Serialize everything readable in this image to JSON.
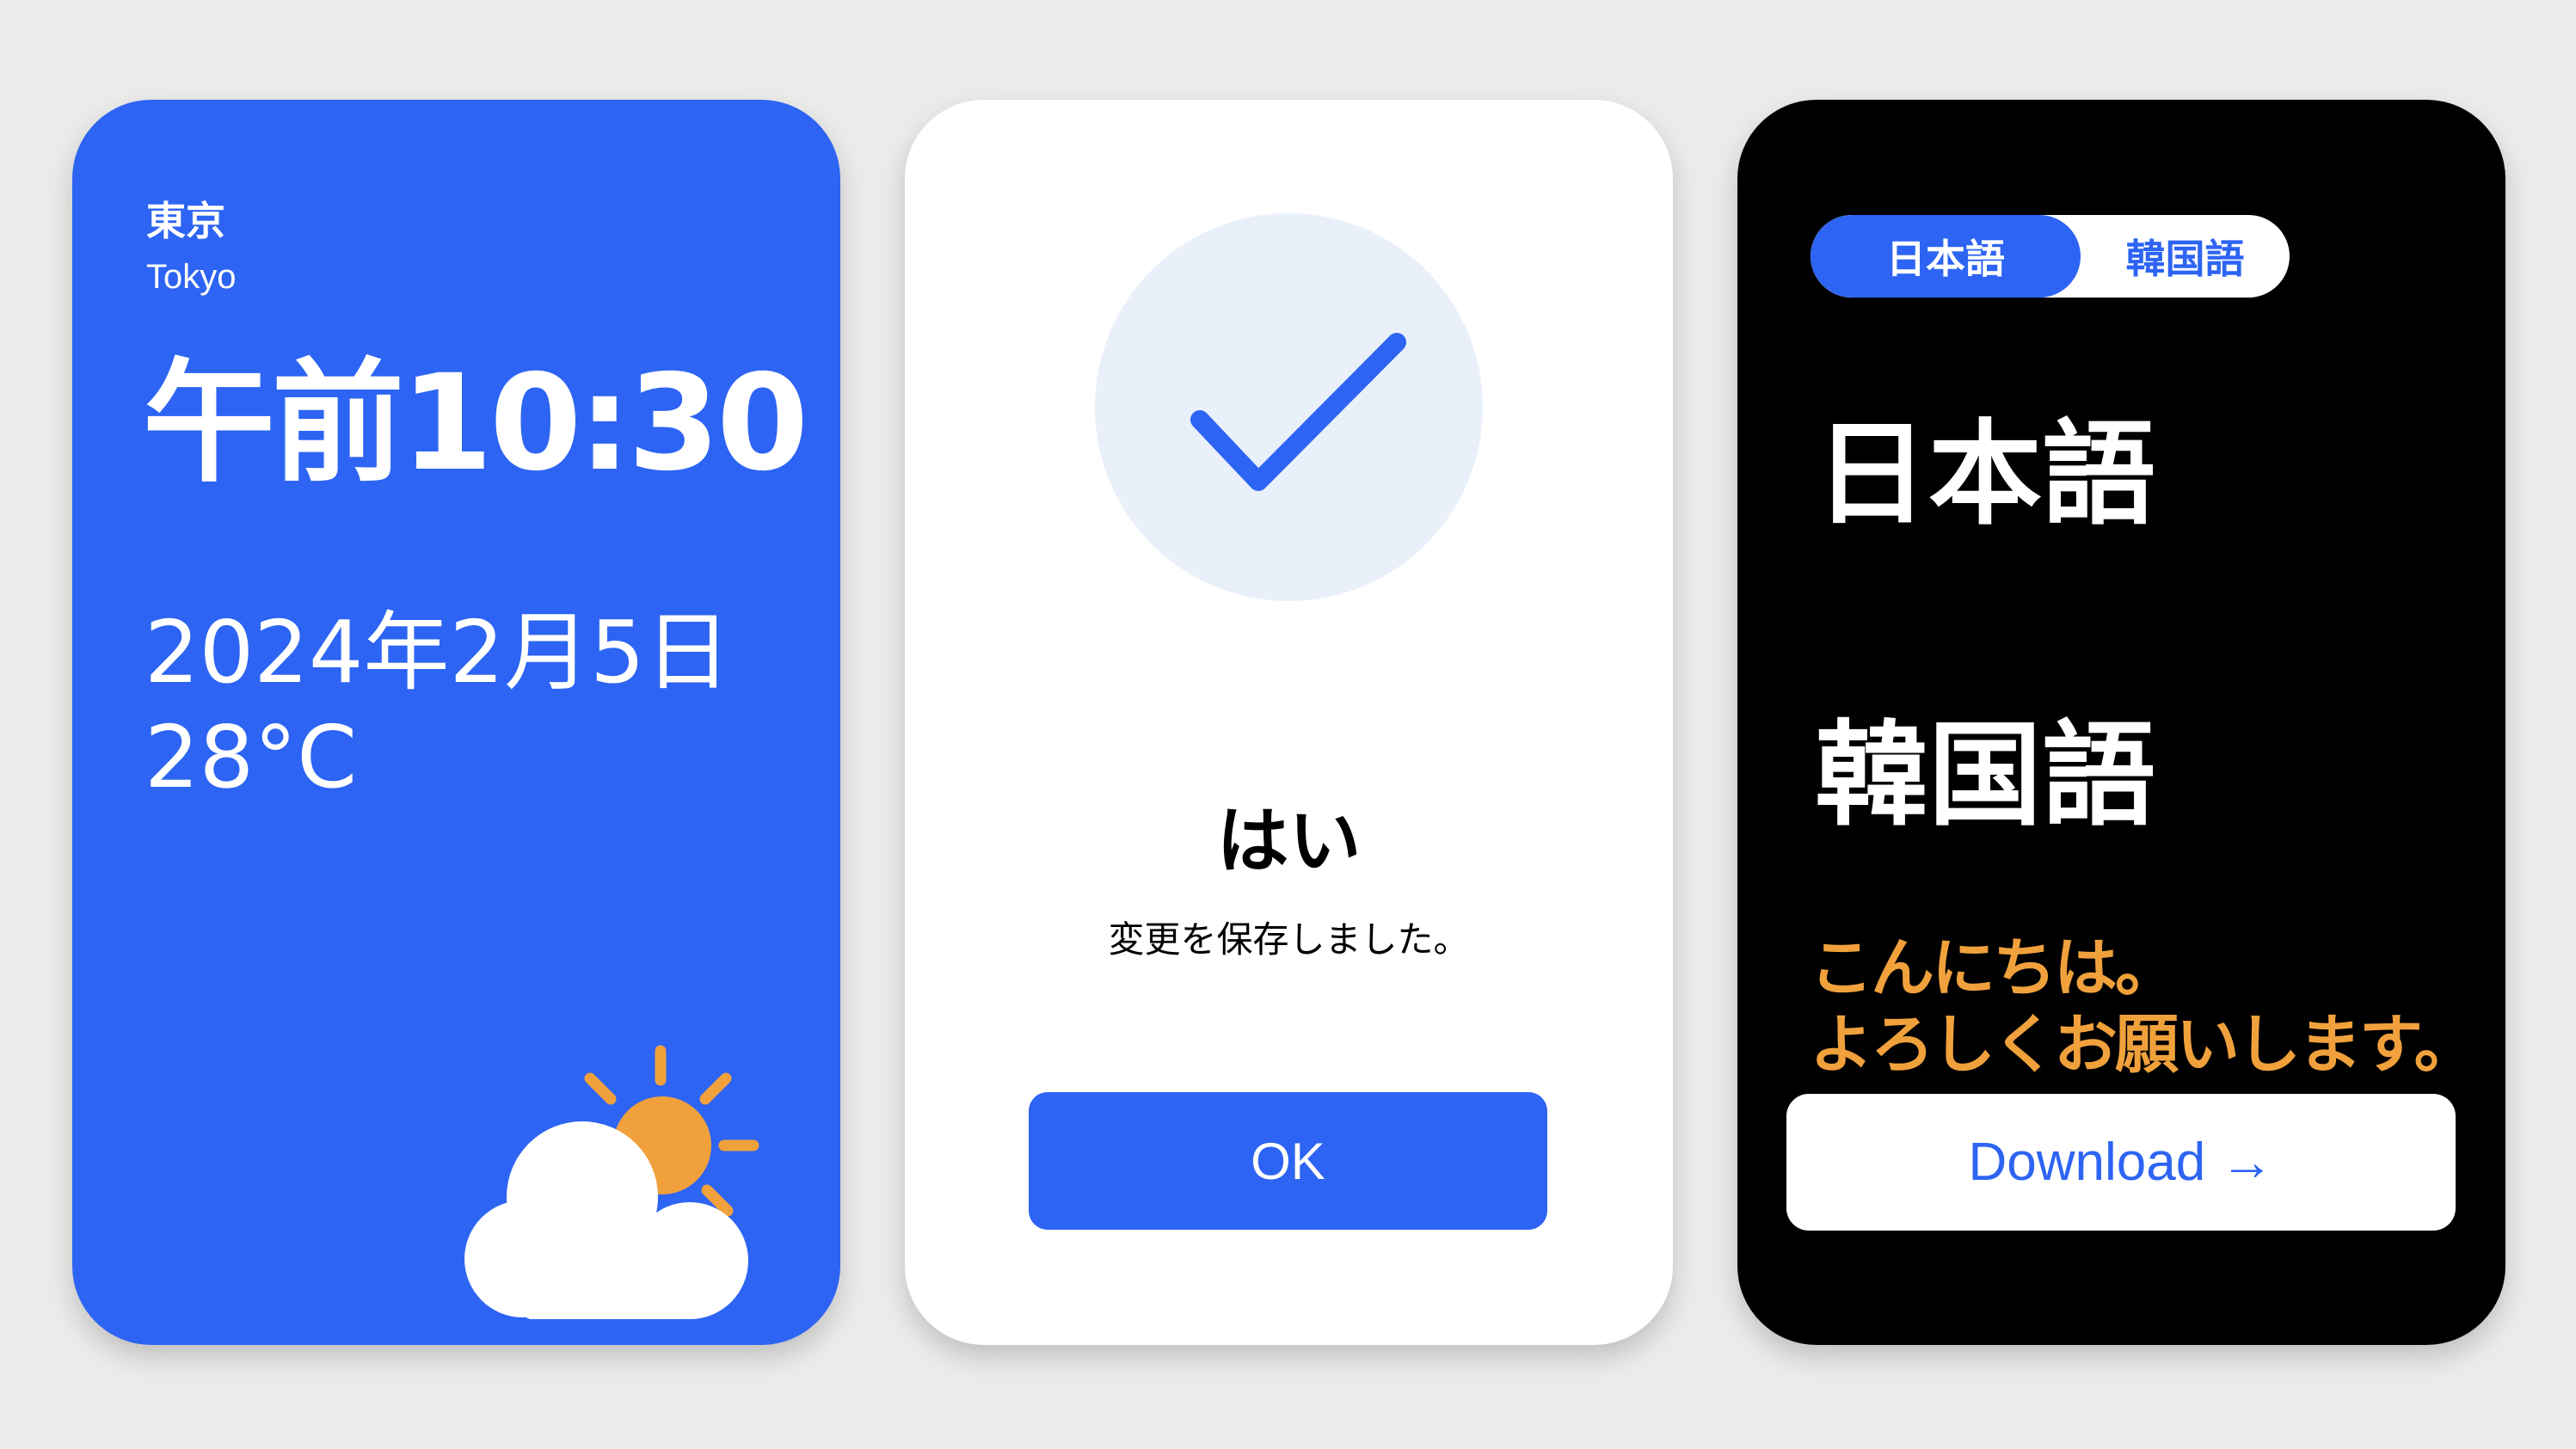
{
  "weather_card": {
    "city_jp": "東京",
    "city_en": "Tokyo",
    "time": "午前10:30",
    "date": "2024年2月5日",
    "temperature": "28°C",
    "icon": "partly-cloudy-icon",
    "background_color": "#2d64f3",
    "sun_color": "#f0a13c"
  },
  "dialog_card": {
    "icon": "checkmark-icon",
    "title": "はい",
    "message": "変更を保存しました。",
    "ok_label": "OK",
    "accent_color": "#2d64f3"
  },
  "language_card": {
    "toggle": {
      "options": [
        "日本語",
        "韓国語"
      ],
      "selected": "日本語"
    },
    "heading_1": "日本語",
    "heading_2": "韓国語",
    "greeting_line1": "こんにちは。",
    "greeting_line2": "よろしくお願いします。",
    "greeting_color": "#f0a13c",
    "download_label": "Download →"
  }
}
